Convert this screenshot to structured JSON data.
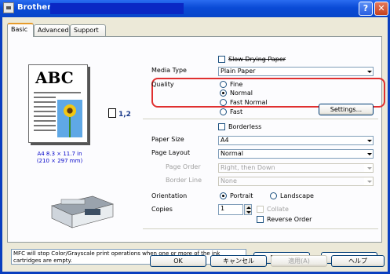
{
  "window": {
    "title": "Brother"
  },
  "tabs": [
    {
      "label": "Basic"
    },
    {
      "label": "Advanced"
    },
    {
      "label": "Support"
    }
  ],
  "preview": {
    "abc_text": "ABC",
    "copies_label": "1,2",
    "paper_line1": "A4 8.3 × 11.7 in",
    "paper_line2": "(210 × 297 mm)"
  },
  "settings": {
    "slow_drying_label": "Slow Drying Paper",
    "media_type_label": "Media Type",
    "media_type_value": "Plain Paper",
    "quality_label": "Quality",
    "quality_options": [
      "Fine",
      "Normal",
      "Fast Normal",
      "Fast"
    ],
    "settings_button": "Settings...",
    "borderless_label": "Borderless",
    "paper_size_label": "Paper Size",
    "paper_size_value": "A4",
    "page_layout_label": "Page Layout",
    "page_layout_value": "Normal",
    "page_order_label": "Page Order",
    "page_order_value": "Right, then Down",
    "border_line_label": "Border Line",
    "border_line_value": "None",
    "orientation_label": "Orientation",
    "portrait_label": "Portrait",
    "landscape_label": "Landscape",
    "copies_label": "Copies",
    "copies_value": "1",
    "collate_label": "Collate",
    "reverse_order_label": "Reverse Order"
  },
  "footer": {
    "note": "MFC will stop Color/Grayscale print operations when one or more of the ink cartridges are empty.",
    "default_button": "Default",
    "about_button": "About...",
    "ok_button": "OK",
    "cancel_button": "キャンセル",
    "apply_button": "適用(A)",
    "help_button": "ヘルプ"
  },
  "colors": {
    "titlebar": "#0a4ad6",
    "highlight_ring": "#e03030",
    "radio_selected": "#21a121"
  },
  "icons": {
    "title_icon": "printer-icon",
    "help": "question-icon",
    "close": "close-icon"
  }
}
